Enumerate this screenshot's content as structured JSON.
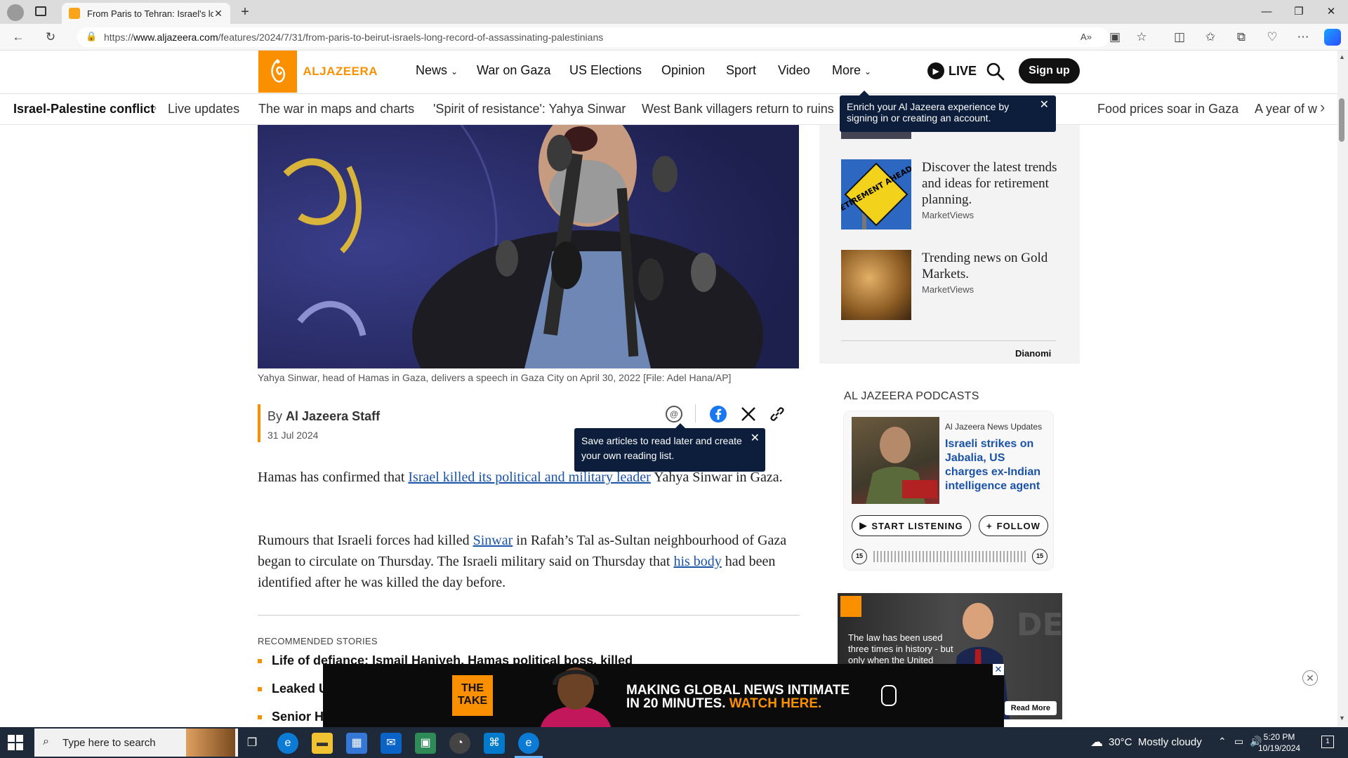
{
  "browser": {
    "tab_title": "From Paris to Tehran: Israel's long",
    "url_prefix": "https://",
    "url_host": "www.aljazeera.com",
    "url_path": "/features/2024/7/31/from-paris-to-beirut-israels-long-record-of-assassinating-palestinians"
  },
  "site": {
    "logo_text": "ALJAZEERA",
    "nav": [
      "News",
      "War on Gaza",
      "US Elections",
      "Opinion",
      "Sport",
      "Video",
      "More"
    ],
    "live_label": "LIVE",
    "signup_label": "Sign up"
  },
  "topic_bar": {
    "title": "Israel-Palestine conflict",
    "items": [
      "Live updates",
      "The war in maps and charts",
      "'Spirit of resistance': Yahya Sinwar",
      "West Bank villagers return to ruins",
      "Food prices soar in Gaza",
      "A year of w"
    ]
  },
  "tooltip_account": "Enrich your Al Jazeera experience by signing in or creating an account.",
  "hero": {
    "caption": "Yahya Sinwar, head of Hamas in Gaza, delivers a speech in Gaza City on April 30, 2022 [File: Adel Hana/AP]"
  },
  "byline": {
    "by": "By",
    "author": "Al Jazeera Staff",
    "date": "31 Jul 2024"
  },
  "tooltip_save": "Save articles to read later and create your own reading list.",
  "article": {
    "p1_pre": "Hamas has confirmed that ",
    "p1_link": "Israel killed its political and military leader",
    "p1_post": " Yahya Sinwar in Gaza.",
    "p2_pre": "Rumours that Israeli forces had killed ",
    "p2_link1": "Sinwar",
    "p2_mid": " in Rafah’s Tal as-Sultan neighbourhood of Gaza began to circulate on Thursday. The Israeli military said on Thursday that ",
    "p2_link2": "his body",
    "p2_post": " had been identified after he was killed the day before."
  },
  "recommended": {
    "heading": "RECOMMENDED STORIES",
    "items": [
      "Life of defiance: Ismail Haniyeh, Hamas political boss, killed",
      "Leaked U",
      "Senior Ha"
    ]
  },
  "sidebar": {
    "promos": [
      {
        "title": "Discover the latest trends and ideas for retirement planning.",
        "source": "MarketViews",
        "sign_text": "RETIREMENT AHEAD"
      },
      {
        "title": "Trending news on Gold Markets.",
        "source": "MarketViews"
      }
    ],
    "dianomi": "Dianomi",
    "podcasts_heading": "AL JAZEERA PODCASTS",
    "podcast": {
      "show": "Al Jazeera News Updates",
      "title": "Israeli strikes on Jabalia, US charges ex-Indian intelligence agent",
      "listen_label": "START LISTENING",
      "follow_label": "FOLLOW",
      "skip_back": "15",
      "skip_forward": "15"
    },
    "ad": {
      "text": "The law has been used three times in history - but only when the United",
      "button": "Read More"
    }
  },
  "bottom_ad": {
    "logo": "THE TAKE",
    "line1": "MAKING GLOBAL NEWS INTIMATE",
    "line2_pre": "IN 20 MINUTES. ",
    "line2_accent": "WATCH HERE."
  },
  "taskbar": {
    "search_placeholder": "Type here to search",
    "temperature": "30°C",
    "weather": "Mostly cloudy",
    "time": "5:20 PM",
    "date": "10/19/2024"
  },
  "colors": {
    "accent": "#fa9000",
    "link": "#1b53a8",
    "tooltip": "#0c1e3c"
  }
}
